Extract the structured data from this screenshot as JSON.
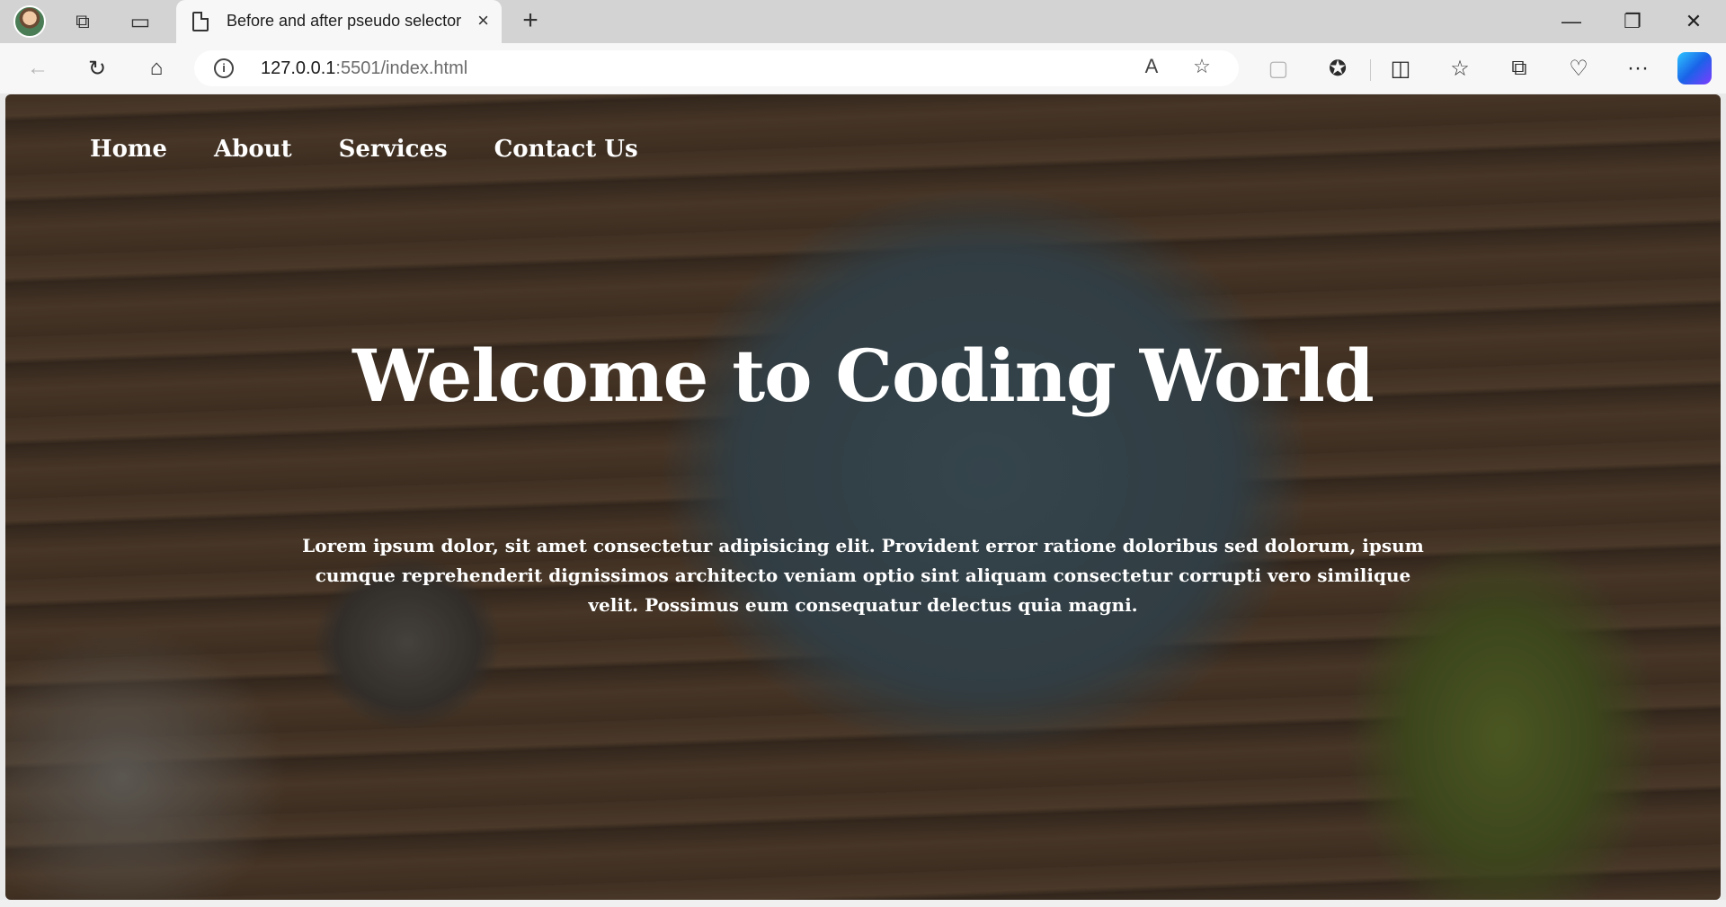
{
  "browser": {
    "tab_title": "Before and after pseudo selector",
    "tab_close_icon": "×",
    "new_tab_icon": "+",
    "url_host": "127.0.0.1",
    "url_rest": ":5501/index.html",
    "window_minimize": "—",
    "window_restore": "❐",
    "window_close": "✕",
    "icons": {
      "back": "←",
      "refresh": "↻",
      "home": "⌂",
      "info": "i",
      "read_aloud": "A",
      "favorite": "☆",
      "extension_box": "▢",
      "extensions": "✪",
      "split_screen": "◫",
      "favorites": "☆",
      "collections": "⧉",
      "browser_essentials": "♡",
      "more": "···",
      "workspaces": "⧉",
      "vertical_tabs": "▭"
    }
  },
  "page": {
    "nav": [
      "Home",
      "About",
      "Services",
      "Contact Us"
    ],
    "title": "Welcome to Coding World",
    "body": "Lorem ipsum dolor, sit amet consectetur adipisicing elit. Provident error ratione doloribus sed dolorum, ipsum cumque reprehenderit dignissimos architecto veniam optio sint aliquam consectetur corrupti vero similique velit. Possimus eum consequatur delectus quia magni."
  }
}
